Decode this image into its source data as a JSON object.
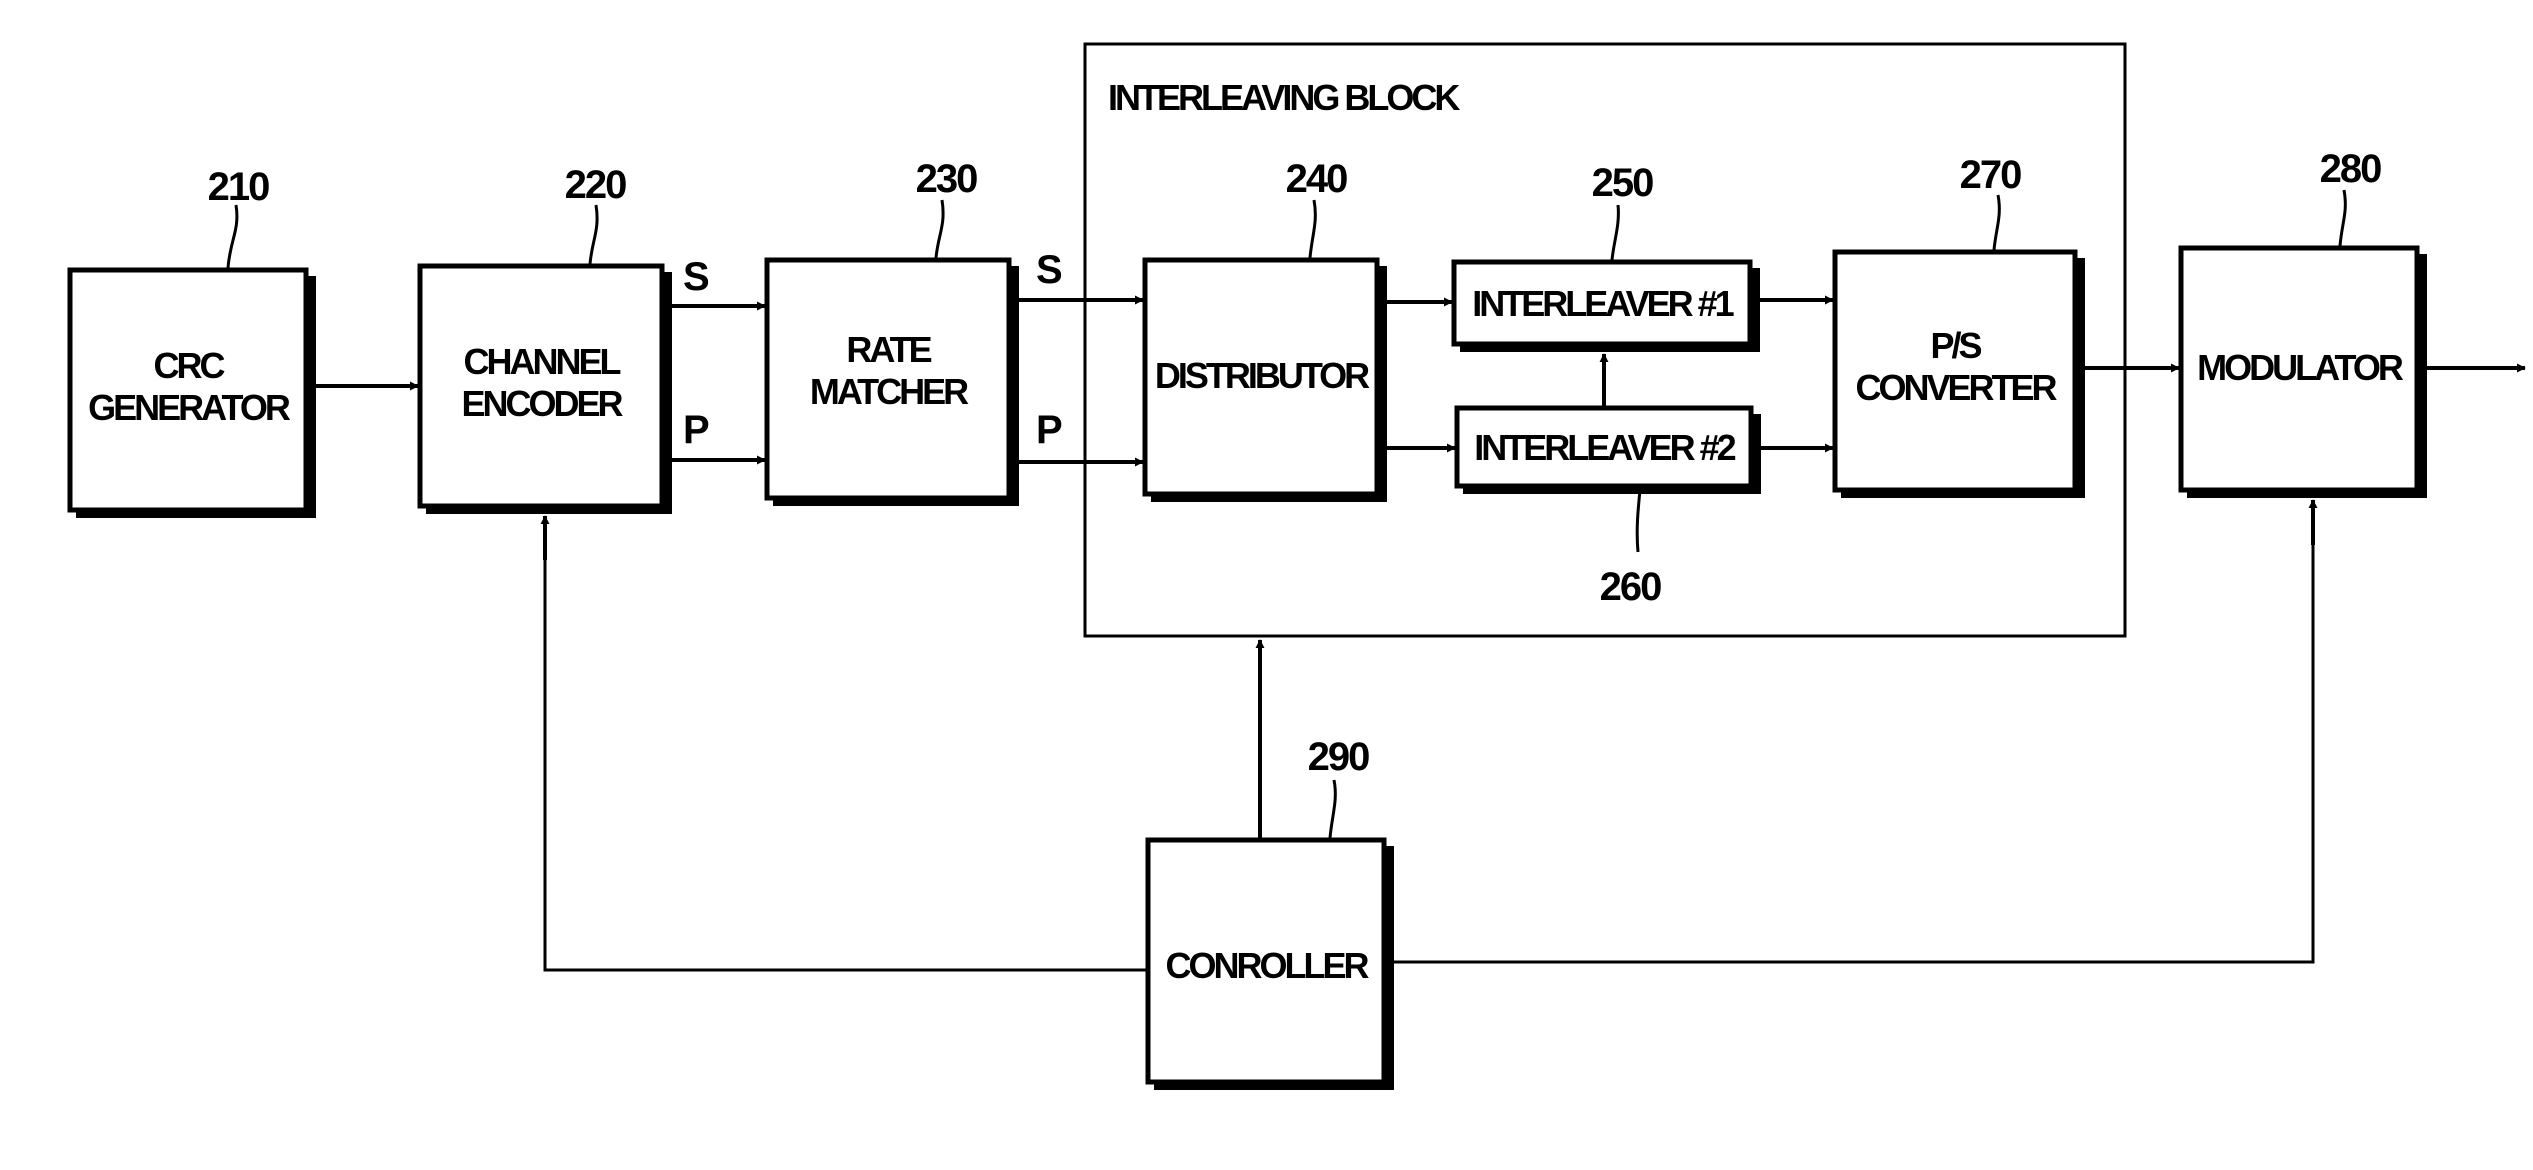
{
  "figure": {
    "interleaving_block": {
      "title": "INTERLEAVING BLOCK"
    },
    "blocks": [
      {
        "id": "crc",
        "ref": "210",
        "lines": [
          "CRC",
          "GENERATOR"
        ]
      },
      {
        "id": "encoder",
        "ref": "220",
        "lines": [
          "CHANNEL",
          "ENCODER"
        ]
      },
      {
        "id": "rate",
        "ref": "230",
        "lines": [
          "RATE",
          "MATCHER"
        ]
      },
      {
        "id": "dist",
        "ref": "240",
        "lines": [
          "DISTRIBUTOR"
        ]
      },
      {
        "id": "int1",
        "ref": "250",
        "lines": [
          "INTERLEAVER #1"
        ]
      },
      {
        "id": "int2",
        "ref": "260",
        "lines": [
          "INTERLEAVER #2"
        ]
      },
      {
        "id": "ps",
        "ref": "270",
        "lines": [
          "P/S",
          "CONVERTER"
        ]
      },
      {
        "id": "mod",
        "ref": "280",
        "lines": [
          "MODULATOR"
        ]
      },
      {
        "id": "ctrl",
        "ref": "290",
        "lines": [
          "CONROLLER"
        ]
      }
    ],
    "signals": {
      "enc_s": "S",
      "enc_p": "P",
      "rate_s": "S",
      "rate_p": "P"
    }
  }
}
